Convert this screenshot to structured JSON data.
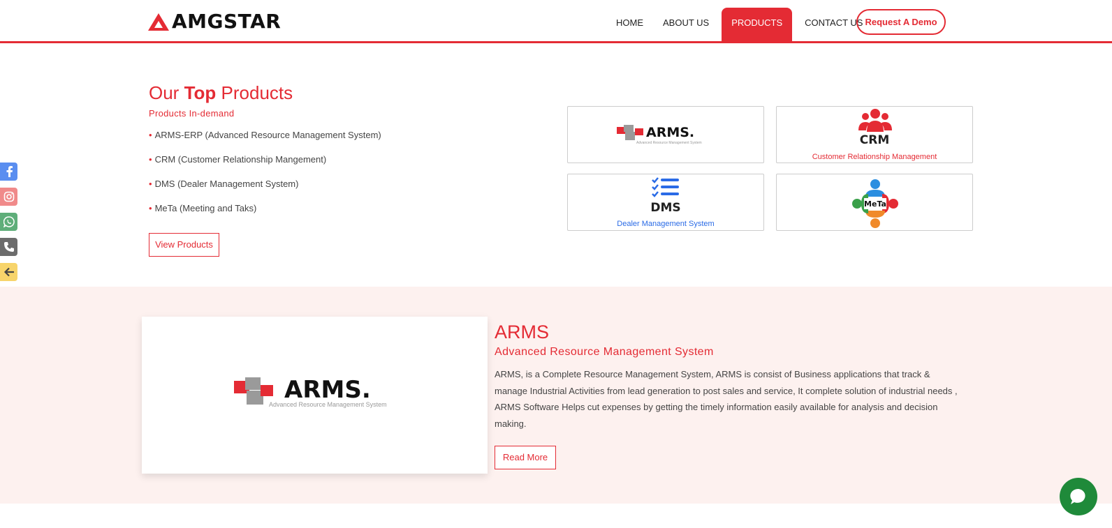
{
  "brand": {
    "name": "AMGSTAR",
    "accent": "#e42b34"
  },
  "nav": {
    "items": [
      {
        "label": "HOME",
        "active": false
      },
      {
        "label": "ABOUT US",
        "active": false
      },
      {
        "label": "PRODUCTS",
        "active": true
      },
      {
        "label": "CONTACT US",
        "active": false
      }
    ],
    "demo_label": "Request A Demo"
  },
  "top_products": {
    "title_pre": "Our",
    "title_bold": "Top",
    "title_post": "Products",
    "subtitle": "Products In-demand",
    "items": [
      "ARMS-ERP (Advanced Resource Management System)",
      "CRM (Customer Relationship Mangement)",
      "DMS (Dealer Management System)",
      "MeTa (Meeting and Taks)"
    ],
    "view_label": "View Products"
  },
  "cards": {
    "arms": {
      "logo": "ARMS.",
      "tagline": "Advanced Resource Management System"
    },
    "crm": {
      "logo": "CRM",
      "caption": "Customer Relationship Management",
      "caption_color": "#e42b34"
    },
    "dms": {
      "logo": "DMS",
      "caption": "Dealer Management System",
      "caption_color": "#2a6be6"
    },
    "meta": {
      "logo": "MeTa"
    }
  },
  "social": [
    {
      "icon": "facebook-icon",
      "color": "#5a8ef0"
    },
    {
      "icon": "instagram-icon",
      "color": "#f08a8a"
    },
    {
      "icon": "whatsapp-icon",
      "color": "#5fae7a"
    },
    {
      "icon": "phone-icon",
      "color": "#6c6c6c"
    },
    {
      "icon": "arrow-left-icon",
      "color": "#f7d46b"
    }
  ],
  "arms_section": {
    "title": "ARMS",
    "subtitle": "Advanced Resource Management System",
    "description": "ARMS, is a Complete Resource Management System, ARMS is consist of Business applications that track & manage Industrial Activities from lead generation to post sales and service, It complete solution of industrial needs , ARMS Software Helps cut expenses by getting the timely information easily available for analysis and decision making.",
    "logo": "ARMS.",
    "logo_tagline": "Advanced Resource Management System",
    "read_more_label": "Read More"
  },
  "chat": {
    "icon": "chat-bubble-icon",
    "color": "#1f8a3a"
  }
}
